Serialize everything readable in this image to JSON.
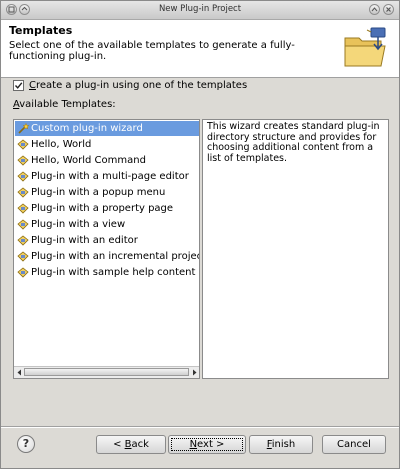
{
  "window": {
    "title": "New Plug-in Project"
  },
  "header": {
    "title": "Templates",
    "description": "Select one of the available templates to generate a fully-functioning plug-in."
  },
  "checkbox": {
    "mnemonic": "C",
    "label_rest": "reate a plug-in using one of the templates",
    "checked": true
  },
  "available": {
    "mnemonic": "A",
    "label_rest": "vailable Templates:"
  },
  "templates": [
    {
      "label": "Custom plug-in wizard",
      "selected": true
    },
    {
      "label": "Hello, World"
    },
    {
      "label": "Hello, World Command"
    },
    {
      "label": "Plug-in with a multi-page editor"
    },
    {
      "label": "Plug-in with a popup menu"
    },
    {
      "label": "Plug-in with a property page"
    },
    {
      "label": "Plug-in with a view"
    },
    {
      "label": "Plug-in with an editor"
    },
    {
      "label": "Plug-in with an incremental project b"
    },
    {
      "label": "Plug-in with sample help content"
    }
  ],
  "description_text": "This wizard creates standard plug-in directory structure and provides for choosing additional content from a list of templates.",
  "buttons": {
    "help": "?",
    "back": {
      "pre": "< ",
      "mnemonic": "B",
      "rest": "ack"
    },
    "next": {
      "mnemonic": "N",
      "rest": "ext >"
    },
    "finish": {
      "mnemonic": "F",
      "rest": "inish"
    },
    "cancel": "Cancel"
  },
  "colors": {
    "selection": "#6a9bdf",
    "dialog_bg": "#dcdad5"
  }
}
